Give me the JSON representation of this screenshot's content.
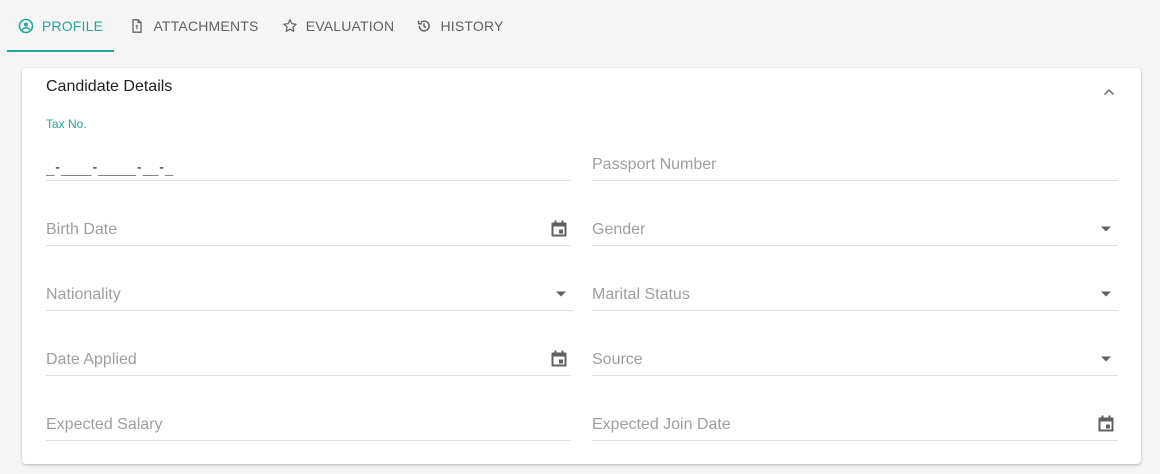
{
  "tabs": [
    {
      "label": "PROFILE",
      "icon": "account-circle-icon",
      "active": true
    },
    {
      "label": "ATTACHMENTS",
      "icon": "file-icon",
      "active": false
    },
    {
      "label": "EVALUATION",
      "icon": "star-icon",
      "active": false
    },
    {
      "label": "HISTORY",
      "icon": "history-icon",
      "active": false
    }
  ],
  "colors": {
    "accent": "#26a69a"
  },
  "card": {
    "title": "Candidate Details"
  },
  "fields": {
    "tax_no": {
      "label": "Tax No.",
      "value": "_-____-_____-__-_"
    },
    "passport_number": {
      "placeholder": "Passport Number"
    },
    "birth_date": {
      "placeholder": "Birth Date"
    },
    "gender": {
      "placeholder": "Gender"
    },
    "nationality": {
      "placeholder": "Nationality"
    },
    "marital_status": {
      "placeholder": "Marital Status"
    },
    "date_applied": {
      "placeholder": "Date Applied"
    },
    "source": {
      "placeholder": "Source"
    },
    "expected_salary": {
      "placeholder": "Expected Salary"
    },
    "expected_join_date": {
      "placeholder": "Expected Join Date"
    }
  }
}
